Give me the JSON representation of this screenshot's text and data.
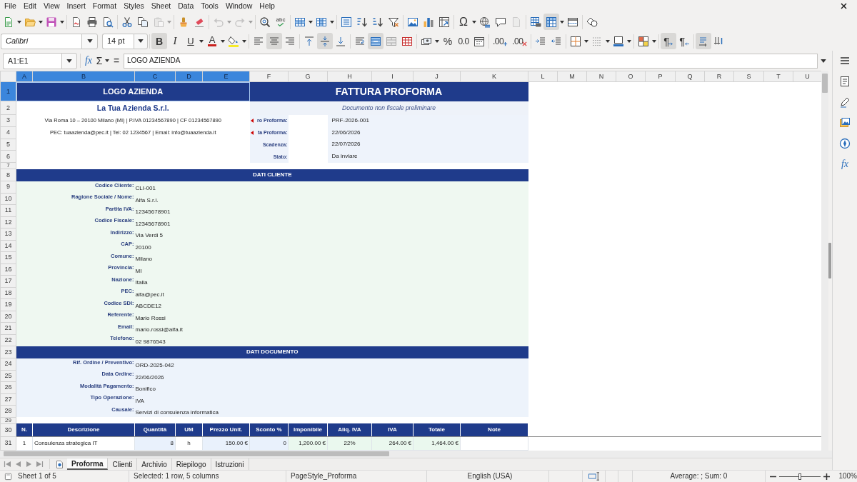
{
  "menu": [
    "File",
    "Edit",
    "View",
    "Insert",
    "Format",
    "Styles",
    "Sheet",
    "Data",
    "Tools",
    "Window",
    "Help"
  ],
  "standard_toolbar": {
    "paste": {
      "disabled": true
    },
    "undo": {
      "disabled": true
    },
    "redo": {
      "disabled": true
    },
    "spelling": {
      "text": "abc"
    },
    "special_character": {
      "text": "Ω"
    },
    "headers_footers": {
      "disabled": true
    },
    "freeze_rows_columns": {
      "pressed": true
    }
  },
  "formatting_toolbar": {
    "font_name": "Calibri",
    "font_size": "14 pt",
    "bold": {
      "text": "B",
      "pressed": true
    },
    "italic": {
      "text": "I",
      "pressed": false
    },
    "underline": {
      "text": "U",
      "pressed": false
    },
    "font_color": {
      "text": "A"
    },
    "align_left": {
      "pressed": false
    },
    "align_center": {
      "pressed": true
    },
    "align_right": {
      "pressed": false
    },
    "align_top": {
      "pressed": false
    },
    "align_middle": {
      "pressed": true
    },
    "align_bottom": {
      "pressed": false
    },
    "wrap_text": {
      "pressed": false
    },
    "merge_center": {
      "pressed": true
    },
    "percent": {
      "text": "%"
    },
    "number": {
      "text": "0.0"
    },
    "add_decimal": {
      "text": ".00"
    },
    "delete_decimal": {
      "text": ".00"
    },
    "left_to_right": {
      "text": "¶",
      "pressed": true
    },
    "right_to_left": {
      "text": "¶",
      "pressed": false
    },
    "text_left_to_right": {
      "pressed": true
    },
    "text_top_to_bottom": {
      "pressed": false
    }
  },
  "formula_bar": {
    "name_box": "A1:E1",
    "function_wizard": "fx",
    "sum": "Σ",
    "formula": "=",
    "content": "LOGO AZIENDA"
  },
  "sheet": {
    "columns": [
      {
        "label": "A",
        "selected": true
      },
      {
        "label": "B",
        "selected": true
      },
      {
        "label": "C",
        "selected": true
      },
      {
        "label": "D",
        "selected": true
      },
      {
        "label": "E",
        "selected": true
      },
      {
        "label": "F",
        "selected": false
      },
      {
        "label": "G",
        "selected": false
      },
      {
        "label": "H",
        "selected": false
      },
      {
        "label": "I",
        "selected": false
      },
      {
        "label": "J",
        "selected": false
      },
      {
        "label": "K",
        "selected": false
      },
      {
        "label": "L",
        "selected": false
      },
      {
        "label": "M",
        "selected": false
      },
      {
        "label": "N",
        "selected": false
      },
      {
        "label": "O",
        "selected": false
      },
      {
        "label": "P",
        "selected": false
      },
      {
        "label": "Q",
        "selected": false
      },
      {
        "label": "R",
        "selected": false
      },
      {
        "label": "S",
        "selected": false
      },
      {
        "label": "T",
        "selected": false
      },
      {
        "label": "U",
        "selected": false
      }
    ],
    "row_numbers": [
      {
        "label": "1",
        "selected": true
      },
      {
        "label": "2",
        "selected": false
      },
      {
        "label": "3",
        "selected": false
      },
      {
        "label": "4",
        "selected": false
      },
      {
        "label": "5",
        "selected": false
      },
      {
        "label": "6",
        "selected": false
      },
      {
        "label": "7",
        "selected": false
      },
      {
        "label": "8",
        "selected": false
      },
      {
        "label": "9",
        "selected": false
      },
      {
        "label": "10",
        "selected": false
      },
      {
        "label": "11",
        "selected": false
      },
      {
        "label": "12",
        "selected": false
      },
      {
        "label": "13",
        "selected": false
      },
      {
        "label": "14",
        "selected": false
      },
      {
        "label": "15",
        "selected": false
      },
      {
        "label": "16",
        "selected": false
      },
      {
        "label": "17",
        "selected": false
      },
      {
        "label": "18",
        "selected": false
      },
      {
        "label": "19",
        "selected": false
      },
      {
        "label": "20",
        "selected": false
      },
      {
        "label": "21",
        "selected": false
      },
      {
        "label": "22",
        "selected": false
      },
      {
        "label": "23",
        "selected": false
      },
      {
        "label": "24",
        "selected": false
      },
      {
        "label": "25",
        "selected": false
      },
      {
        "label": "26",
        "selected": false
      },
      {
        "label": "27",
        "selected": false
      },
      {
        "label": "28",
        "selected": false
      },
      {
        "label": "29",
        "selected": false
      },
      {
        "label": "30",
        "selected": false
      },
      {
        "label": "31",
        "selected": false
      }
    ],
    "logo": "LOGO AZIENDA",
    "title": "FATTURA PROFORMA",
    "company_name": "La Tua Azienda S.r.l.",
    "subtitle": "Documento non fiscale preliminare",
    "company_lines": [
      "Via Roma 10 – 20100 Milano (MI) | P.IVA 01234567890 | CF 01234567890",
      "PEC: tuaazienda@pec.it | Tel: 02 1234567 | Email: info@tuaazienda.it"
    ],
    "document_info": [
      {
        "label": "ro Proforma:",
        "value": "PRF-2026-001",
        "clipped": true
      },
      {
        "label": "ta Proforma:",
        "value": "22/06/2026",
        "clipped": true
      },
      {
        "label": "Scadenza:",
        "value": "22/07/2026",
        "clipped": false
      },
      {
        "label": "Stato:",
        "value": "Da inviare",
        "clipped": false
      }
    ],
    "sections": [
      {
        "title": "DATI CLIENTE",
        "kind": "client",
        "fields": [
          {
            "label": "Codice Cliente:",
            "value": "CLI-001"
          },
          {
            "label": "Ragione Sociale / Nome:",
            "value": "Alfa S.r.l."
          },
          {
            "label": "Partita IVA:",
            "value": "12345678901"
          },
          {
            "label": "Codice Fiscale:",
            "value": "12345678901"
          },
          {
            "label": "Indirizzo:",
            "value": "Via Verdi 5"
          },
          {
            "label": "CAP:",
            "value": "20100"
          },
          {
            "label": "Comune:",
            "value": "Milano"
          },
          {
            "label": "Provincia:",
            "value": "MI"
          },
          {
            "label": "Nazione:",
            "value": "Italia"
          },
          {
            "label": "PEC:",
            "value": "alfa@pec.it"
          },
          {
            "label": "Codice SDI:",
            "value": "ABCDE12"
          },
          {
            "label": "Referente:",
            "value": "Mario Rossi"
          },
          {
            "label": "Email:",
            "value": "mario.rossi@alfa.it"
          },
          {
            "label": "Telefono:",
            "value": "02 9876543"
          }
        ]
      },
      {
        "title": "DATI DOCUMENTO",
        "kind": "document",
        "fields": [
          {
            "label": "Rif. Ordine / Preventivo:",
            "value": "ORD-2025-042"
          },
          {
            "label": "Data Ordine:",
            "value": "22/06/2026"
          },
          {
            "label": "Modalità Pagamento:",
            "value": "Bonifico"
          },
          {
            "label": "Tipo Operazione:",
            "value": "IVA"
          },
          {
            "label": "Causale:",
            "value": "Servizi di consulenza informatica"
          }
        ]
      }
    ],
    "items": {
      "columns": [
        "N.",
        "Descrizione",
        "Quantità",
        "UM",
        "Prezzo Unit.",
        "Sconto %",
        "Imponibile",
        "Aliq. IVA",
        "IVA",
        "Totale",
        "Note"
      ],
      "rows": [
        {
          "cells": [
            "1",
            "Consulenza strategica IT",
            "8",
            "h",
            "150.00 €",
            "0",
            "1,200.00 €",
            "22%",
            "264.00 €",
            "1,464.00 €"
          ]
        }
      ]
    }
  },
  "sheet_tabs": [
    {
      "label": "Proforma",
      "selected": true
    },
    {
      "label": "Clienti",
      "selected": false
    },
    {
      "label": "Archivio",
      "selected": false
    },
    {
      "label": "Riepilogo",
      "selected": false
    },
    {
      "label": "Istruzioni",
      "selected": false
    }
  ],
  "sidebar": {
    "functions": "fx"
  },
  "status_bar": {
    "sheet": "Sheet 1 of 5",
    "selection": "Selected: 1 row, 5 columns",
    "page_style": "PageStyle_Proforma",
    "language": "English (USA)",
    "summary": "Average: ; Sum: 0",
    "zoom_slider": {
      "level": 0.5
    },
    "zoom": "100%"
  }
}
